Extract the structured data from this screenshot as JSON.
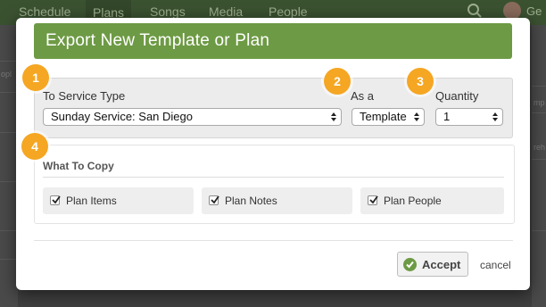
{
  "nav": {
    "items": [
      "Schedule",
      "Plans",
      "Songs",
      "Media",
      "People"
    ],
    "user_initial": "Ge"
  },
  "background": {
    "left_fragment": "opl",
    "right_fragments": [
      "mp",
      "reh"
    ]
  },
  "modal": {
    "title": "Export New Template or Plan",
    "service_type": {
      "label": "To Service Type",
      "value": "Sunday Service: San Diego"
    },
    "as_a": {
      "label": "As a",
      "value": "Template"
    },
    "quantity": {
      "label": "Quantity",
      "value": "1"
    },
    "what_to_copy": {
      "title": "What To Copy",
      "options": [
        {
          "label": "Plan Items",
          "checked": true
        },
        {
          "label": "Plan Notes",
          "checked": true
        },
        {
          "label": "Plan People",
          "checked": true
        }
      ]
    },
    "accept_label": "Accept",
    "cancel_label": "cancel"
  },
  "callouts": [
    "1",
    "2",
    "3",
    "4"
  ],
  "colors": {
    "header_green": "#6d9a44",
    "badge_orange": "#f5a623",
    "nav_dark": "#3b5231"
  }
}
